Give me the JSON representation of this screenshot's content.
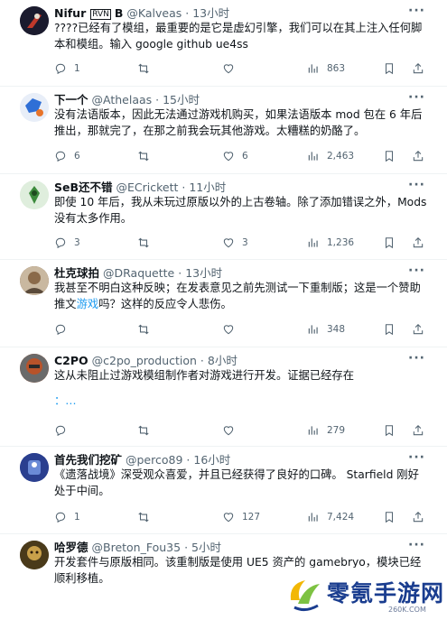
{
  "tweets": [
    {
      "name": "Nifur",
      "name_suffix": "RVN",
      "name_tail": "B",
      "handle": "@Kalveas",
      "sep": "·",
      "time": "13小时",
      "text": "????已经有了模组，最重要的是它是虚幻引擎，我们可以在其上注入任何脚本和模组。输入 google github ue4ss",
      "replies": "1",
      "retweets": "",
      "likes": "",
      "views": "863",
      "avatar_color": "#1b1b2e"
    },
    {
      "name": "下一个",
      "handle": "@Athelaas",
      "sep": "·",
      "time": "15小时",
      "text": "没有法语版本，因此无法通过游戏机购买，如果法语版本 mod 包在 6 年后推出，那就完了，在那之前我会玩其他游戏。太糟糕的奶酪了。",
      "replies": "6",
      "retweets": "",
      "likes": "6",
      "views": "2,463",
      "avatar_color": "#2f6fd6"
    },
    {
      "name": "SeB还不错",
      "handle": "@ECrickett",
      "sep": "·",
      "time": "11小时",
      "text": "即使 10 年后，我从未玩过原版以外的上古卷轴。除了添加错误之外，Mods 没有太多作用。",
      "replies": "3",
      "retweets": "",
      "likes": "3",
      "views": "1,236",
      "avatar_color": "#3c8a3c"
    },
    {
      "name": "杜克球拍",
      "handle": "@DRaquette",
      "sep": "·",
      "time": "13小时",
      "text_before": "我甚至不明白这种反映；在发表意见之前先测试一下重制版；这是一个赞助推文",
      "text_link": "游戏",
      "text_after": "吗？这样的反应令人悲伤。",
      "replies": "",
      "retweets": "",
      "likes": "",
      "views": "348",
      "avatar_color": "#8a6a4a"
    },
    {
      "name": "C2PO",
      "handle": "@c2po_production",
      "sep": "·",
      "time": "8小时",
      "text": "这从未阻止过游戏模组制作者对游戏进行开发。证据已经存在",
      "text_link": "：…",
      "replies": "",
      "retweets": "",
      "likes": "",
      "views": "279",
      "avatar_color": "#b8532a"
    },
    {
      "name": "首先我们挖矿",
      "handle": "@perco89",
      "sep": "·",
      "time": "16小时",
      "text": "《遗落战境》深受观众喜爱，并且已经获得了良好的口碑。 Starfield 刚好处于中间。",
      "replies": "1",
      "retweets": "",
      "likes": "127",
      "views": "7,424",
      "avatar_color": "#2a3f8f"
    },
    {
      "name": "哈罗德",
      "handle": "@Breton_Fou35",
      "sep": "·",
      "time": "5小时",
      "text": "开发套件与原版相同。该重制版是使用 UE5 资产的 gamebryo，模块已经顺利移植。",
      "avatar_color": "#4a3a1a"
    }
  ],
  "watermark": {
    "title": "零氪手游网",
    "subtitle": "260K.COM"
  },
  "icons": [
    "more-icon",
    "reply-icon",
    "retweet-icon",
    "like-icon",
    "views-icon",
    "bookmark-icon",
    "share-icon"
  ],
  "colors": {
    "link": "#1d9bf0",
    "muted": "#536471",
    "text": "#0f1419"
  }
}
